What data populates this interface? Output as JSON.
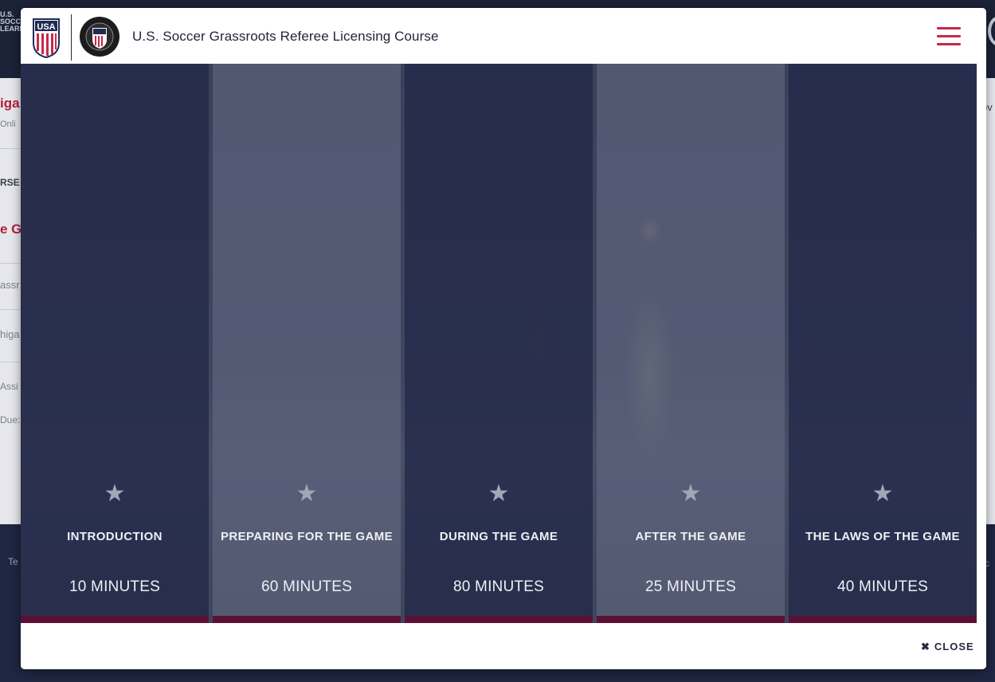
{
  "background": {
    "brand_text": "U.S. SOCCER LEARNING",
    "left_fragments": [
      "iga",
      "Onli",
      "RSE",
      "e Gr",
      "assr",
      "higa",
      "Assi",
      "Due:"
    ],
    "right_fragment": "ov",
    "footer_left": "Te",
    "footer_right": "c"
  },
  "modal": {
    "title": "U.S. Soccer Grassroots Referee Licensing Course",
    "usa_logo_text": "USA",
    "close_label": "CLOSE",
    "close_icon": "times-icon",
    "menu_icon": "hamburger-icon",
    "accent_color": "#c8284a"
  },
  "modules": [
    {
      "title": "INTRODUCTION",
      "duration": "10 MINUTES",
      "icon": "star-icon"
    },
    {
      "title": "PREPARING FOR THE GAME",
      "duration": "60 MINUTES",
      "icon": "star-icon"
    },
    {
      "title": "DURING THE GAME",
      "duration": "80 MINUTES",
      "icon": "star-icon"
    },
    {
      "title": "AFTER THE GAME",
      "duration": "25 MINUTES",
      "icon": "star-icon"
    },
    {
      "title": "THE LAWS OF THE GAME",
      "duration": "40 MINUTES",
      "icon": "star-icon"
    }
  ]
}
